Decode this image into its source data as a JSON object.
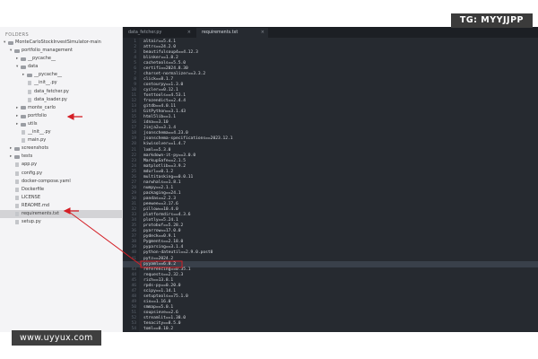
{
  "badge": "TG: MYYJJPP",
  "watermark": "www.uyyux.com",
  "sidebar": {
    "header": "FOLDERS",
    "items": [
      {
        "label": "MonteCarloStockInvestSimulator-main",
        "depth": 0,
        "kind": "folder",
        "open": true
      },
      {
        "label": "portfolio_management",
        "depth": 1,
        "kind": "folder",
        "open": true
      },
      {
        "label": "__pycache__",
        "depth": 2,
        "kind": "folder",
        "open": false
      },
      {
        "label": "data",
        "depth": 2,
        "kind": "folder",
        "open": true
      },
      {
        "label": "__pycache__",
        "depth": 3,
        "kind": "folder",
        "open": false
      },
      {
        "label": "__init__.py",
        "depth": 3,
        "kind": "file"
      },
      {
        "label": "data_fetcher.py",
        "depth": 3,
        "kind": "file"
      },
      {
        "label": "data_loader.py",
        "depth": 3,
        "kind": "file"
      },
      {
        "label": "monte_carlo",
        "depth": 2,
        "kind": "folder",
        "open": false
      },
      {
        "label": "portfolio",
        "depth": 2,
        "kind": "folder",
        "open": false
      },
      {
        "label": "utils",
        "depth": 2,
        "kind": "folder",
        "open": false
      },
      {
        "label": "__init__.py",
        "depth": 2,
        "kind": "file"
      },
      {
        "label": "main.py",
        "depth": 2,
        "kind": "file"
      },
      {
        "label": "screenshots",
        "depth": 1,
        "kind": "folder",
        "open": false
      },
      {
        "label": "tests",
        "depth": 1,
        "kind": "folder",
        "open": false
      },
      {
        "label": "app.py",
        "depth": 1,
        "kind": "file"
      },
      {
        "label": "config.py",
        "depth": 1,
        "kind": "file"
      },
      {
        "label": "docker-compose.yaml",
        "depth": 1,
        "kind": "file"
      },
      {
        "label": "Dockerfile",
        "depth": 1,
        "kind": "file"
      },
      {
        "label": "LICENSE",
        "depth": 1,
        "kind": "file"
      },
      {
        "label": "README.md",
        "depth": 1,
        "kind": "file"
      },
      {
        "label": "requirements.txt",
        "depth": 1,
        "kind": "file",
        "selected": true
      },
      {
        "label": "setup.py",
        "depth": 1,
        "kind": "file"
      }
    ]
  },
  "tabs": [
    {
      "label": "data_fetcher.py",
      "active": false,
      "close": "×"
    },
    {
      "label": "requirements.txt",
      "active": true,
      "close": "×"
    }
  ],
  "editor": {
    "first_line": 1,
    "highlight_line": 42,
    "lines": [
      "altair==5.4.1",
      "attrs==24.2.0",
      "beautifulsoup4==4.12.3",
      "blinker==1.8.2",
      "cachetools==5.5.0",
      "certifi==2024.8.30",
      "charset-normalizer==3.3.2",
      "click==8.1.7",
      "contourpy==1.3.0",
      "cycler==0.12.1",
      "fonttools==4.53.1",
      "frozendict==2.4.4",
      "gitdb==4.0.11",
      "GitPython==3.1.43",
      "html5lib==1.1",
      "idna==3.10",
      "Jinja2==3.1.4",
      "jsonschema==4.23.0",
      "jsonschema-specifications==2023.12.1",
      "kiwisolver==1.4.7",
      "lxml==5.3.0",
      "markdown-it-py==3.0.0",
      "MarkupSafe==2.1.5",
      "matplotlib==3.9.2",
      "mdurl==0.1.2",
      "multitasking==0.0.11",
      "narwhals==1.8.1",
      "numpy==2.1.1",
      "packaging==24.1",
      "pandas==2.2.3",
      "peewee==3.17.6",
      "pillow==10.4.0",
      "platformdirs==4.3.6",
      "plotly==5.24.1",
      "protobuf==5.28.2",
      "pyarrow==17.0.0",
      "pydeck==0.9.1",
      "Pygments==2.18.0",
      "pyparsing==3.1.4",
      "python-dateutil==2.9.0.post0",
      "pytz==2024.2",
      "pyyaml==6.0.2",
      "referencing==0.35.1",
      "requests==2.32.3",
      "rich==13.8.1",
      "rpds-py==0.20.0",
      "scipy==1.14.1",
      "setuptools==75.1.0",
      "six==1.16.0",
      "smmap==5.0.1",
      "soupsieve==2.6",
      "streamlit==1.38.0",
      "tenacity==8.5.0",
      "toml==0.10.2"
    ]
  },
  "colors": {
    "accent_arrow": "#d41f26",
    "editor_bg": "#262a30",
    "sidebar_bg": "#f4f4f6"
  }
}
